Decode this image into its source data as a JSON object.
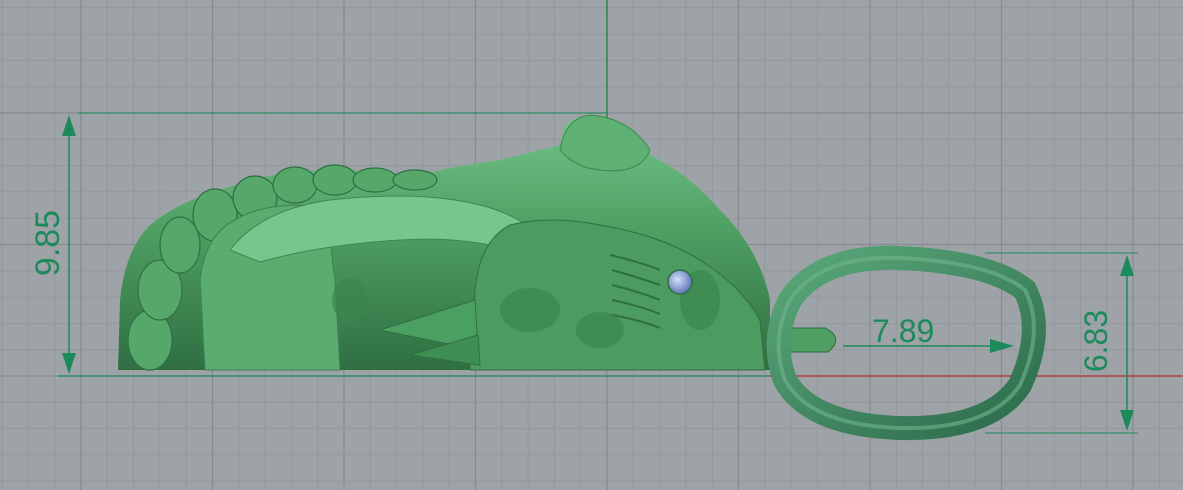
{
  "viewport": {
    "background": "#9ea3a8",
    "grid_minor_color": "#8f959a",
    "grid_major_color": "#858b90",
    "axis_x_color": "#b24040",
    "axis_y_color": "#2c8a4e"
  },
  "model": {
    "body_color": "#4f9f63",
    "highlight_color": "#6fc184",
    "shadow_color": "#2f6f42",
    "gem_color": "#8fa6d8"
  },
  "dimensions": {
    "height": "9.85",
    "loop_width": "7.89",
    "loop_height": "6.83",
    "color": "#1d8a5c"
  }
}
